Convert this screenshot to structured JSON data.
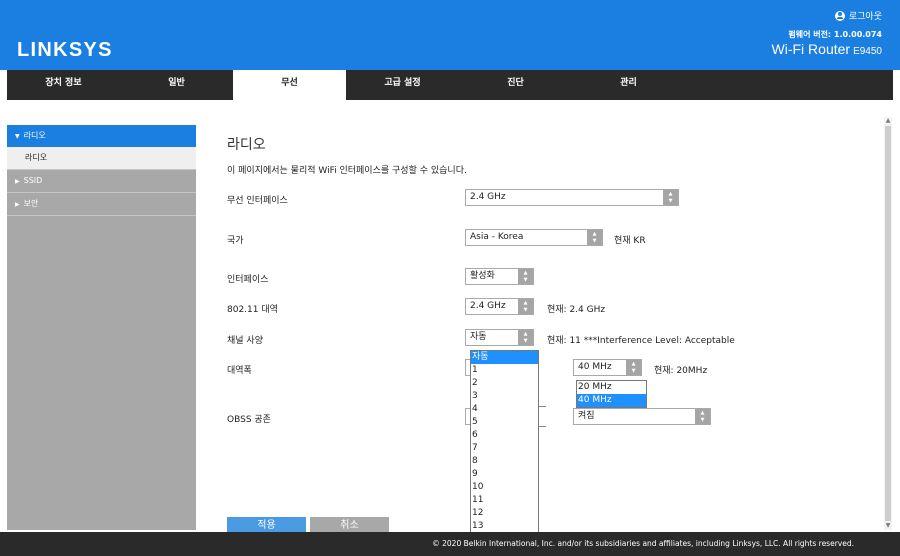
{
  "header": {
    "logo": "LINKSYS",
    "logout_label": "로그아웃",
    "firmware": "펌웨어 버전: 1.0.00.074",
    "product_name": "Wi-Fi Router",
    "model": "E9450"
  },
  "nav": {
    "tabs": [
      {
        "label": "장치 정보"
      },
      {
        "label": "일반"
      },
      {
        "label": "무선"
      },
      {
        "label": "고급 설정"
      },
      {
        "label": "진단"
      },
      {
        "label": "관리"
      }
    ],
    "active": "무선"
  },
  "sidebar": {
    "items": [
      {
        "label": "라디오"
      },
      {
        "label": "라디오"
      },
      {
        "label": "SSID"
      },
      {
        "label": "보안"
      }
    ]
  },
  "page": {
    "title": "라디오",
    "description": "이 페이지에서는 물리적 WiFi 인터페이스를 구성할 수 있습니다."
  },
  "form": {
    "wireless_interface": {
      "label": "무선 인터페이스",
      "value": "2.4 GHz"
    },
    "country": {
      "label": "국가",
      "value": "Asia - Korea",
      "current": "현재 KR"
    },
    "interface": {
      "label": "인터페이스",
      "value": "활성화"
    },
    "band": {
      "label": "802.11 대역",
      "value": "2.4 GHz",
      "current": "현재: 2.4 GHz"
    },
    "channel": {
      "label": "채널 사양",
      "value": "자동",
      "current": "현재: 11 ***Interference Level: Acceptable"
    },
    "bandwidth": {
      "label": "대역폭",
      "value": "40 MHz",
      "current": "현재: 20MHz"
    },
    "obss": {
      "label": "OBSS 공존",
      "value": "켜짐"
    }
  },
  "channel_dropdown": {
    "options": [
      "자동",
      "1",
      "2",
      "3",
      "4",
      "5",
      "6",
      "7",
      "8",
      "9",
      "10",
      "11",
      "12",
      "13"
    ],
    "selected": "자동"
  },
  "bandwidth_dropdown": {
    "options": [
      "20 MHz",
      "40 MHz"
    ],
    "selected": "40 MHz"
  },
  "buttons": {
    "apply": "적용",
    "cancel": "취소"
  },
  "footer": {
    "copyright": "© 2020 Belkin International, Inc. and/or its subsidiaries and affiliates, including Linksys, LLC. All rights reserved."
  },
  "colors": {
    "brand_blue": "#1b7fe1",
    "nav_dark": "#2a2a2a",
    "sidebar_gray": "#a8a8a8",
    "select_highlight": "#1e90ff",
    "button_apply": "#4a9be3",
    "button_cancel": "#a8a8a8"
  }
}
